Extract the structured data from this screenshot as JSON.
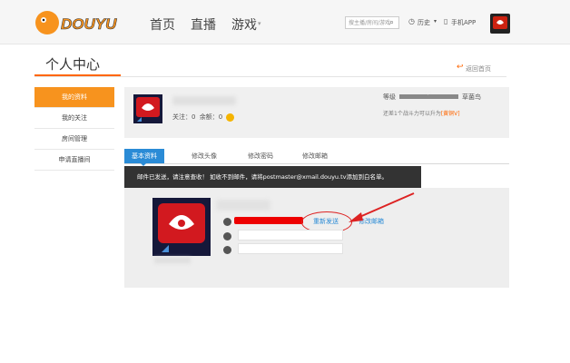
{
  "header": {
    "logo_text": "DOUYU",
    "nav": [
      "首页",
      "直播",
      "游戏"
    ],
    "search_placeholder": "搜主播/房间/游戏",
    "history": "历史",
    "mobile_app": "手机APP"
  },
  "page": {
    "title": "个人中心",
    "back_home": "返回首页"
  },
  "sidebar": {
    "items": [
      {
        "label": "我的资料",
        "active": true
      },
      {
        "label": "我的关注",
        "active": false
      },
      {
        "label": "房间管理",
        "active": false
      },
      {
        "label": "申请直播间",
        "active": false
      }
    ]
  },
  "profile": {
    "follow_label": "关注：",
    "follow_count": "0",
    "balance_label": "余额：",
    "balance_count": "0",
    "level_label": "等级",
    "level_value": "0/1",
    "level_name": "草菌鸟",
    "upgrade_prefix": "还差1个战斗力可以升为",
    "upgrade_rank": "[黄铜V]"
  },
  "tabs": [
    {
      "label": "基本资料",
      "active": true
    },
    {
      "label": "修改头像",
      "active": false
    },
    {
      "label": "修改密码",
      "active": false
    },
    {
      "label": "修改邮箱",
      "active": false
    }
  ],
  "notice": "邮件已发送，请注意查收！ 如收不到邮件，请将postmaster@xmail.douyu.tv添加到白名单。",
  "email_row": {
    "resend": "重新发送",
    "modify": "修改邮箱"
  },
  "colors": {
    "accent_orange": "#f7931e",
    "tab_blue": "#2a8bd6",
    "annotation_red": "#dd2222"
  }
}
